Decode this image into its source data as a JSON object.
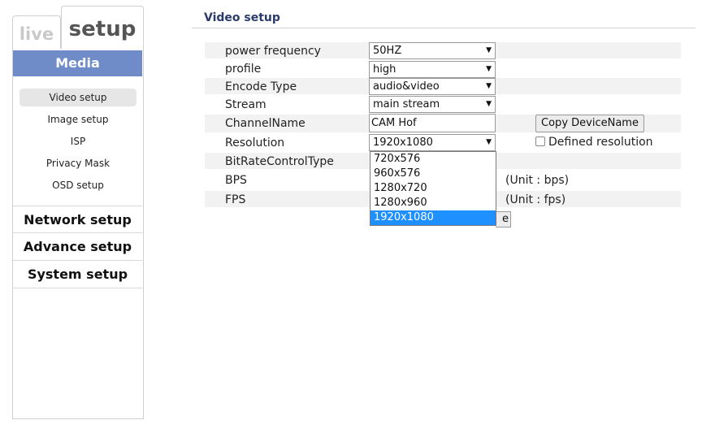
{
  "tabs": {
    "live": "live",
    "setup": "setup"
  },
  "sidebar": {
    "media_header": "Media",
    "media_items": [
      "Video setup",
      "Image setup",
      "ISP",
      "Privacy Mask",
      "OSD setup"
    ],
    "sections": [
      "Network setup",
      "Advance setup",
      "System setup"
    ]
  },
  "page": {
    "title": "Video setup"
  },
  "form": {
    "power_frequency": {
      "label": "power frequency",
      "value": "50HZ"
    },
    "profile": {
      "label": "profile",
      "value": "high"
    },
    "encode_type": {
      "label": "Encode Type",
      "value": "audio&video"
    },
    "stream": {
      "label": "Stream",
      "value": "main stream"
    },
    "channel_name": {
      "label": "ChannelName",
      "value": "CAM Hof",
      "copy_button": "Copy DeviceName"
    },
    "resolution": {
      "label": "Resolution",
      "value": "1920x1080",
      "defined_label": "Defined resolution"
    },
    "bitrate_control": {
      "label": "BitRateControlType"
    },
    "bps": {
      "label": "BPS",
      "unit": "(Unit : bps)"
    },
    "fps": {
      "label": "FPS",
      "unit": "(Unit : fps)"
    },
    "save_button_partial": "e"
  },
  "resolution_dropdown": {
    "options": [
      "720x576",
      "960x576",
      "1280x720",
      "1280x960",
      "1920x1080"
    ],
    "selected": "1920x1080"
  }
}
